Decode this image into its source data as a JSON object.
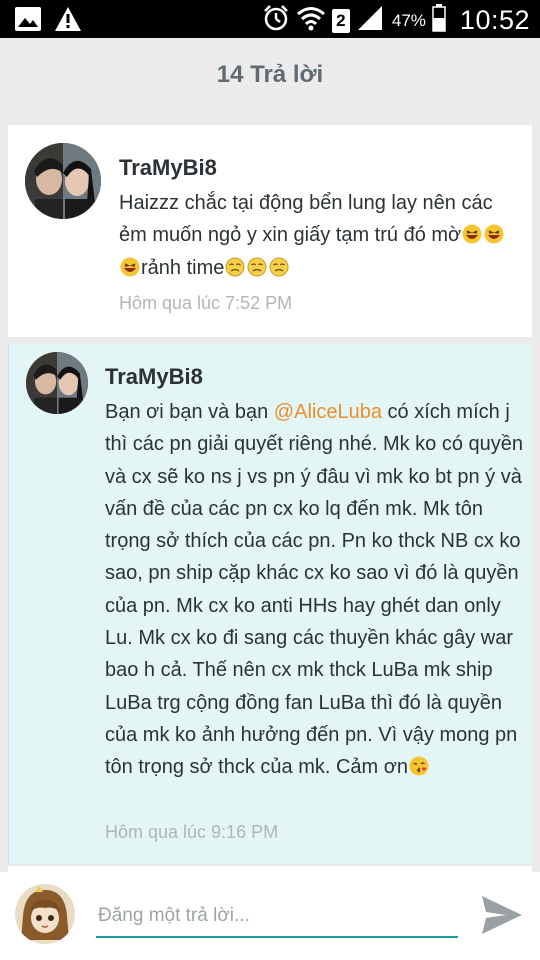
{
  "status_bar": {
    "battery_percent": "47%",
    "time": "10:52",
    "sim_slot": "2",
    "icons": [
      "image-notification-icon",
      "warning-icon",
      "alarm-icon",
      "wifi-icon",
      "sim-icon",
      "signal-icon",
      "battery-icon"
    ]
  },
  "header": {
    "title": "14 Trả lời"
  },
  "comments": [
    {
      "author": "TraMyBi8",
      "text_parts": {
        "p1": "Haizzz chắc tại động bển lung lay nên các ẻm muốn ngỏ y xin giấy tạm trú đó mờ",
        "p2": "rảnh time"
      },
      "timestamp": "Hôm qua lúc 7:52 PM",
      "emojis": [
        "laughing-emoji",
        "laughing-emoji",
        "laughing-emoji",
        "tired-emoji",
        "tired-emoji",
        "tired-emoji"
      ]
    },
    {
      "author": "TraMyBi8",
      "text_parts": {
        "before": "Bạn ơi bạn và bạn ",
        "mention": "@AliceLuba",
        "after": " có xích mích j thì các pn giải quyết riêng nhé. Mk ko có quyền và cx sẽ ko ns j vs pn ý đâu vì mk ko bt pn ý và vấn đề của các pn cx ko lq đến mk. Mk tôn trọng sở thích của các pn. Pn ko thck NB cx ko sao, pn ship cặp khác cx ko sao vì đó là quyền của pn. Mk cx ko anti HHs hay ghét dan only Lu. Mk cx ko đi sang các thuyền khác gây war bao h cả. Thế nên cx mk thck LuBa mk ship LuBa trg cộng đồng fan LuBa thì đó là quyền của mk ko ảnh hưởng đến pn. Vì vậy mong pn tôn trọng sở thck của mk. Cảm ơn"
      },
      "timestamp": "Hôm qua lúc 9:16 PM",
      "emojis": [
        "kiss-emoji"
      ]
    }
  ],
  "composer": {
    "placeholder": "Đăng một trả lời..."
  },
  "colors": {
    "accent": "#1c9a9a",
    "mention": "#e98f2c",
    "highlight_bg": "#e4f5f5"
  }
}
